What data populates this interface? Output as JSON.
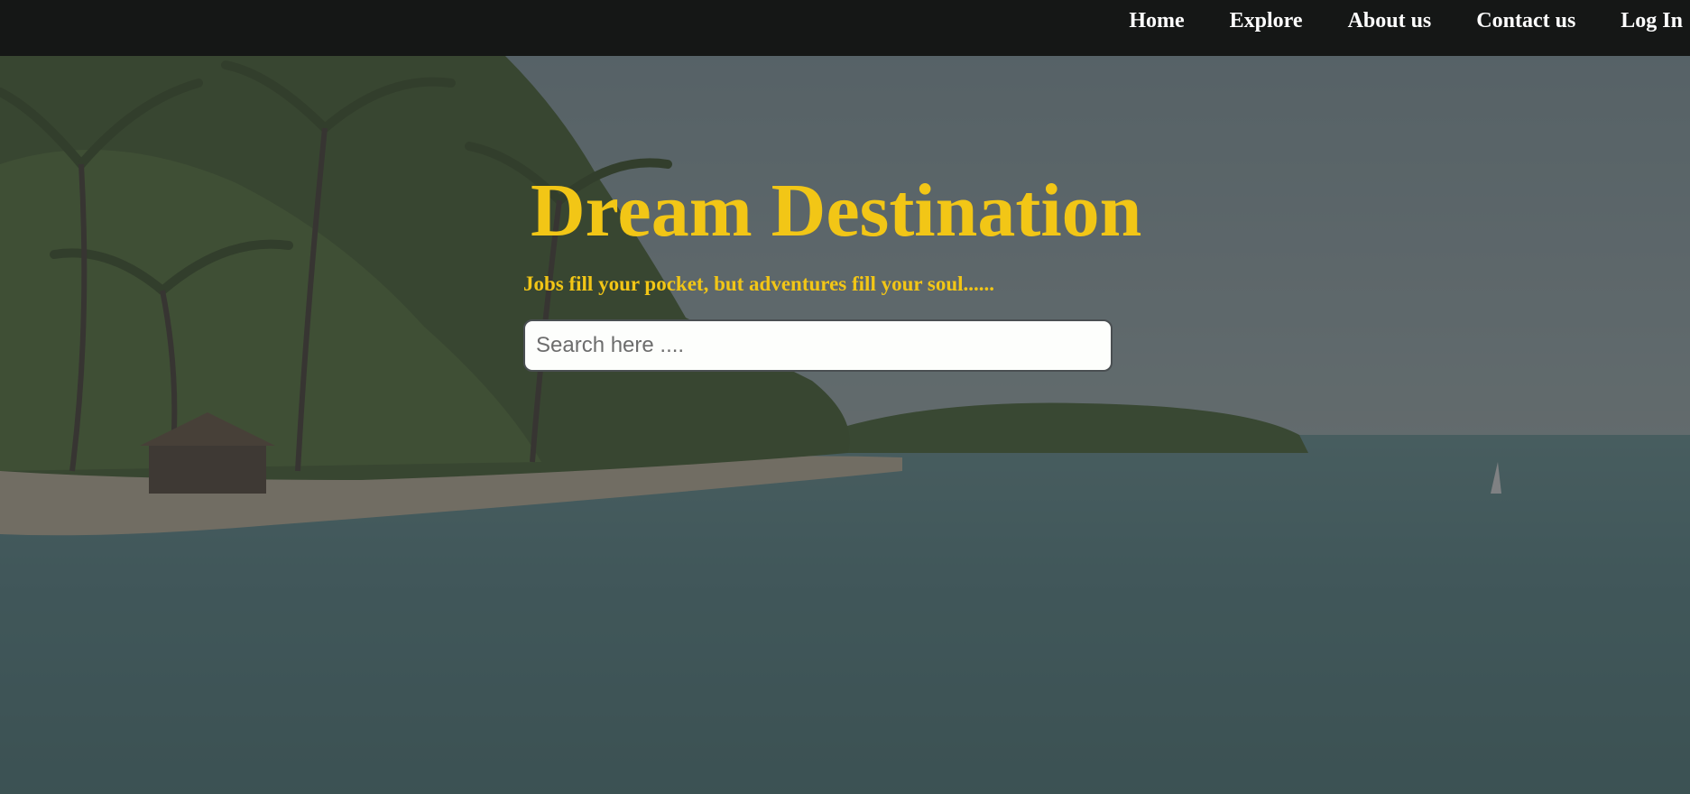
{
  "nav": {
    "items": [
      {
        "label": "Home"
      },
      {
        "label": "Explore"
      },
      {
        "label": "About us"
      },
      {
        "label": "Contact us"
      },
      {
        "label": "Log In"
      }
    ]
  },
  "hero": {
    "title": "Dream Destination",
    "subtitle": "Jobs fill your pocket, but adventures fill your soul......",
    "background_image": "tropical-beach-with-palm-trees"
  },
  "search": {
    "placeholder": "Search here ...."
  },
  "colors": {
    "navbar": "#151716",
    "accent": "#f2c616",
    "nav_text": "#ffffff"
  }
}
